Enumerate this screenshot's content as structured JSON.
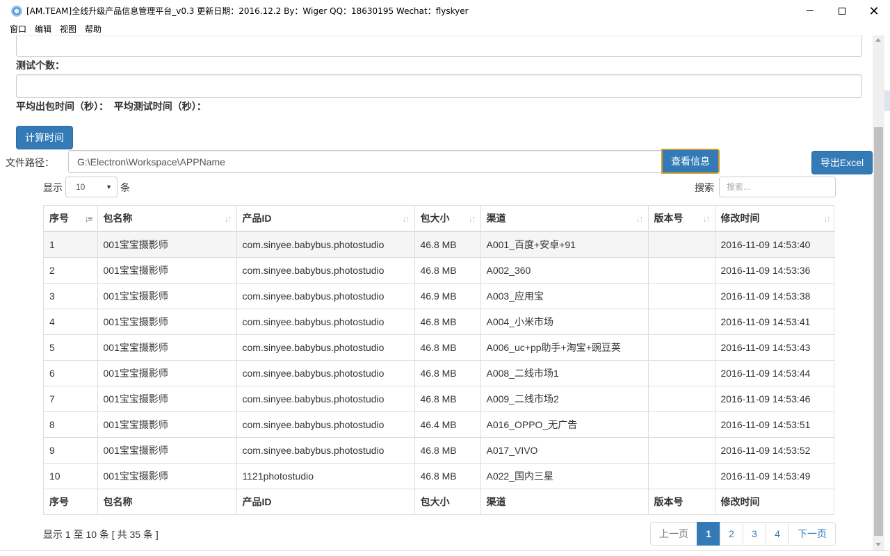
{
  "window": {
    "title": "[AM.TEAM]全线升级产品信息管理平台_v0.3 更新日期：2016.12.2 By：Wiger QQ：18630195 Wechat：flyskyer"
  },
  "menu": [
    "窗口",
    "编辑",
    "视图",
    "帮助"
  ],
  "form": {
    "test_count_label": "测试个数：",
    "avg_time_label": "平均出包时间（秒）：  平均测试时间（秒）：",
    "calc_button": "计算时间",
    "file_path_label": "文件路径：",
    "file_path_value": "G:\\Electron\\Workspace\\APPName",
    "view_info_button": "查看信息",
    "export_button": "导出Excel"
  },
  "table_controls": {
    "show_label": "显示",
    "page_size": "10",
    "rows_unit": "条",
    "search_label": "搜索",
    "search_placeholder": "搜索..."
  },
  "table": {
    "columns": [
      "序号",
      "包名称",
      "产品ID",
      "包大小",
      "渠道",
      "版本号",
      "修改时间"
    ],
    "rows": [
      [
        "1",
        "001宝宝摄影师",
        "com.sinyee.babybus.photostudio",
        "46.8 MB",
        "A001_百度+安卓+91",
        "",
        "2016-11-09 14:53:40"
      ],
      [
        "2",
        "001宝宝摄影师",
        "com.sinyee.babybus.photostudio",
        "46.8 MB",
        "A002_360",
        "",
        "2016-11-09 14:53:36"
      ],
      [
        "3",
        "001宝宝摄影师",
        "com.sinyee.babybus.photostudio",
        "46.9 MB",
        "A003_应用宝",
        "",
        "2016-11-09 14:53:38"
      ],
      [
        "4",
        "001宝宝摄影师",
        "com.sinyee.babybus.photostudio",
        "46.8 MB",
        "A004_小米市场",
        "",
        "2016-11-09 14:53:41"
      ],
      [
        "5",
        "001宝宝摄影师",
        "com.sinyee.babybus.photostudio",
        "46.8 MB",
        "A006_uc+pp助手+淘宝+豌豆荚",
        "",
        "2016-11-09 14:53:43"
      ],
      [
        "6",
        "001宝宝摄影师",
        "com.sinyee.babybus.photostudio",
        "46.8 MB",
        "A008_二线市场1",
        "",
        "2016-11-09 14:53:44"
      ],
      [
        "7",
        "001宝宝摄影师",
        "com.sinyee.babybus.photostudio",
        "46.8 MB",
        "A009_二线市场2",
        "",
        "2016-11-09 14:53:46"
      ],
      [
        "8",
        "001宝宝摄影师",
        "com.sinyee.babybus.photostudio",
        "46.4 MB",
        "A016_OPPO_无广告",
        "",
        "2016-11-09 14:53:51"
      ],
      [
        "9",
        "001宝宝摄影师",
        "com.sinyee.babybus.photostudio",
        "46.8 MB",
        "A017_VIVO",
        "",
        "2016-11-09 14:53:52"
      ],
      [
        "10",
        "001宝宝摄影师",
        "1121photostudio",
        "46.8 MB",
        "A022_国内三星",
        "",
        "2016-11-09 14:53:49"
      ]
    ]
  },
  "footer": {
    "info": "显示 1 至 10 条 [ 共 35 条 ]",
    "pagination": {
      "prev": "上一页",
      "pages": [
        "1",
        "2",
        "3",
        "4"
      ],
      "active_page": "1",
      "next": "下一页"
    }
  },
  "colors": {
    "primary": "#337ab7",
    "focus_border": "#cc9d2c"
  }
}
